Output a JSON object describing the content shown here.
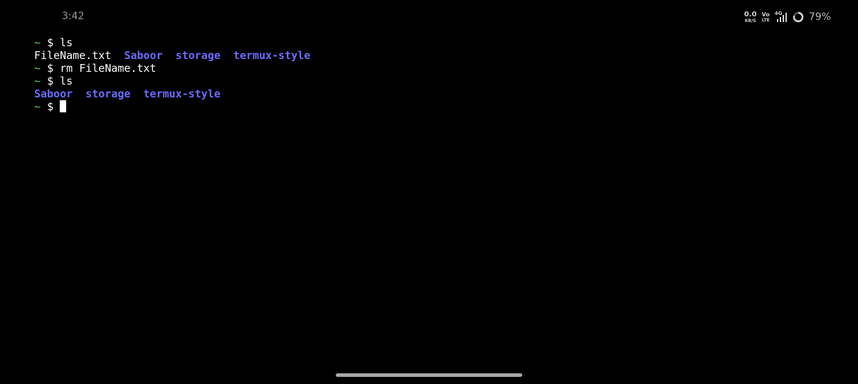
{
  "status_bar": {
    "time": "3:42",
    "net_speed_value": "0.0",
    "net_speed_unit": "KB/S",
    "volte_top": "Vo",
    "volte_bottom": "LTE",
    "network_type": "4G",
    "battery_percent": "79%",
    "battery_level": 0.79,
    "icons": [
      "data-speed-icon",
      "volte-icon",
      "signal-icon",
      "battery-ring-icon"
    ]
  },
  "terminal": {
    "prompt_home": "~",
    "prompt_symbol": "$",
    "lines": [
      {
        "type": "command",
        "command": "ls"
      },
      {
        "type": "output",
        "entries": [
          {
            "name": "FileName.txt",
            "kind": "file"
          },
          {
            "name": "Saboor",
            "kind": "dir"
          },
          {
            "name": "storage",
            "kind": "dir"
          },
          {
            "name": "termux-style",
            "kind": "dir"
          }
        ]
      },
      {
        "type": "command",
        "command": "rm FileName.txt"
      },
      {
        "type": "command",
        "command": "ls"
      },
      {
        "type": "output",
        "entries": [
          {
            "name": "Saboor",
            "kind": "dir"
          },
          {
            "name": "storage",
            "kind": "dir"
          },
          {
            "name": "termux-style",
            "kind": "dir"
          }
        ]
      },
      {
        "type": "prompt",
        "command": ""
      }
    ],
    "colors": {
      "background": "#000000",
      "foreground": "#ffffff",
      "prompt_tilde": "#5fd75f",
      "directory": "#6c6cff"
    }
  }
}
